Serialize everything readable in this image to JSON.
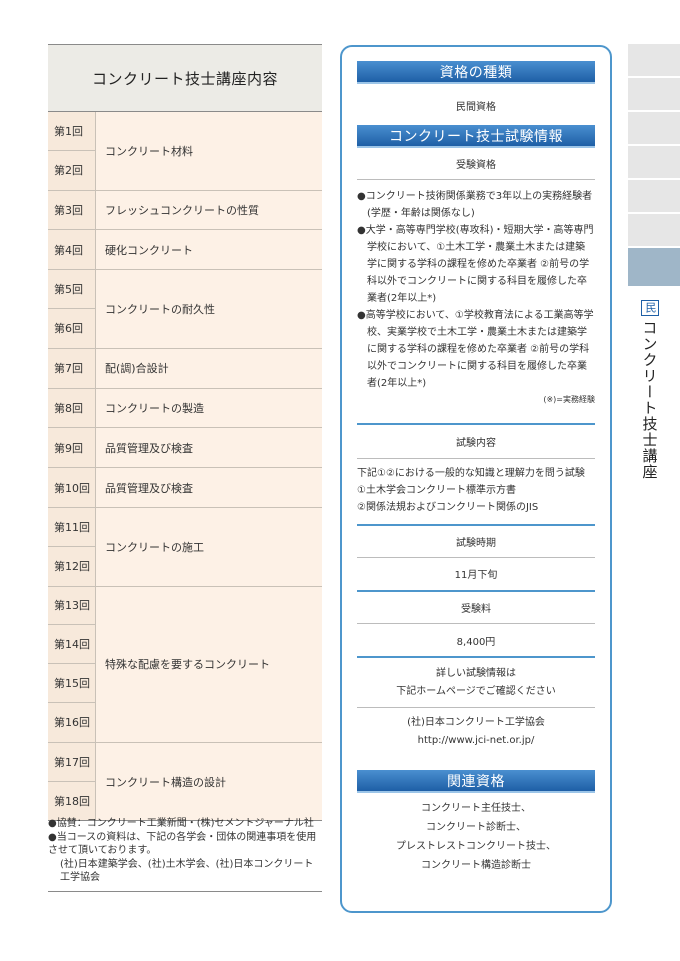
{
  "course": {
    "title": "コンクリート技士講座内容",
    "groups": [
      {
        "nums": [
          "第1回",
          "第2回"
        ],
        "topic": "コンクリート材料"
      },
      {
        "nums": [
          "第3回"
        ],
        "topic": "フレッシュコンクリートの性質"
      },
      {
        "nums": [
          "第4回"
        ],
        "topic": "硬化コンクリート"
      },
      {
        "nums": [
          "第5回",
          "第6回"
        ],
        "topic": "コンクリートの耐久性"
      },
      {
        "nums": [
          "第7回"
        ],
        "topic": "配(調)合設計"
      },
      {
        "nums": [
          "第8回"
        ],
        "topic": "コンクリートの製造"
      },
      {
        "nums": [
          "第9回"
        ],
        "topic": "品質管理及び検査"
      },
      {
        "nums": [
          "第10回"
        ],
        "topic": "品質管理及び検査"
      },
      {
        "nums": [
          "第11回",
          "第12回"
        ],
        "topic": "コンクリートの施工"
      },
      {
        "nums": [
          "第13回",
          "第14回",
          "第15回",
          "第16回"
        ],
        "topic": "特殊な配慮を要するコンクリート"
      },
      {
        "nums": [
          "第17回",
          "第18回"
        ],
        "topic": "コンクリート構造の設計"
      }
    ],
    "notes": {
      "sponsor": "●協賛：コンクリート工業新聞・(株)セメントジャーナル社",
      "materials": "●当コースの資料は、下記の各学会・団体の関連事項を使用させて頂いております。",
      "orgs": "(社)日本建築学会、(社)土木学会、(社)日本コンクリート工学協会"
    }
  },
  "panel": {
    "type_heading": "資格の種類",
    "type_value": "民間資格",
    "exam_heading": "コンクリート技士試験情報",
    "eligibility_label": "受験資格",
    "requirements": [
      "●コンクリート技術関係業務で3年以上の実務経験者(学歴・年齢は関係なし)",
      "●大学・高等専門学校(専攻科)・短期大学・高等専門学校において、①土木工学・農業土木または建築学に関する学科の課程を修めた卒業者 ②前号の学科以外でコンクリートに関する科目を履修した卒業者(2年以上*)",
      "●高等学校において、①学校教育法による工業高等学校、実業学校で土木工学・農業土木または建築学に関する学科の課程を修めた卒業者 ②前号の学科以外でコンクリートに関する科目を履修した卒業者(2年以上*)"
    ],
    "footnote": "(※)=実務経験",
    "content_label": "試験内容",
    "content_lines": [
      "下記①②における一般的な知識と理解力を問う試験",
      "①土木学会コンクリート標準示方書",
      "②関係法規およびコンクリート関係のJIS"
    ],
    "period_label": "試験時期",
    "period_value": "11月下旬",
    "fee_label": "受験料",
    "fee_value": "8,400円",
    "detail_line1": "詳しい試験情報は",
    "detail_line2": "下記ホームページでご確認ください",
    "org_name": "(社)日本コンクリート工学協会",
    "org_url": "http://www.jci-net.or.jp/",
    "related_heading": "関連資格",
    "related": [
      "コンクリート主任技士、",
      "コンクリート診断士、",
      "プレストレストコンクリート技士、",
      "コンクリート構造診断士"
    ]
  },
  "side": {
    "mark": "民",
    "label": "コンクリート技士講座"
  },
  "colors": {
    "band": "#1e5fa6",
    "panel_border": "#4d96cc",
    "row_bg": "#fdf1e6",
    "title_bg": "#ecebe6",
    "tab_active": "#9fb6c8"
  }
}
